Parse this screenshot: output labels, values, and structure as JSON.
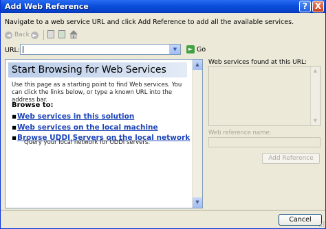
{
  "window": {
    "title": "Add Web Reference",
    "help_glyph": "?",
    "close_glyph": "X"
  },
  "instruction": "Navigate to a web service URL and click Add Reference to add all the available services.",
  "toolbar": {
    "back_label": "Back",
    "back_glyph": "◄",
    "forward_glyph": "►"
  },
  "url_bar": {
    "label": "URL:",
    "value": "",
    "dropdown_glyph": "▼",
    "go_label": "Go",
    "go_glyph": "►"
  },
  "browser": {
    "headline": "Start Browsing for Web Services",
    "intro": "Use this page as a starting point to find Web services. You can click the links below, or type a known URL into the address bar.",
    "browse_to": "Browse to:",
    "bullet": "▪",
    "links": [
      {
        "label": "Web services in this solution"
      },
      {
        "label": "Web services on the local machine"
      },
      {
        "label": "Browse UDDI Servers on the local network",
        "description": "Query your local network for UDDI servers."
      }
    ],
    "scroll_up_glyph": "▲",
    "scroll_down_glyph": "▼"
  },
  "side_panel": {
    "services_found_label": "Web services found at this URL:",
    "scroll_up_glyph": "▲",
    "scroll_down_glyph": "▼",
    "reference_name_label": "Web reference name:",
    "reference_name_value": "",
    "add_reference_label": "Add Reference"
  },
  "footer": {
    "cancel_label": "Cancel"
  }
}
